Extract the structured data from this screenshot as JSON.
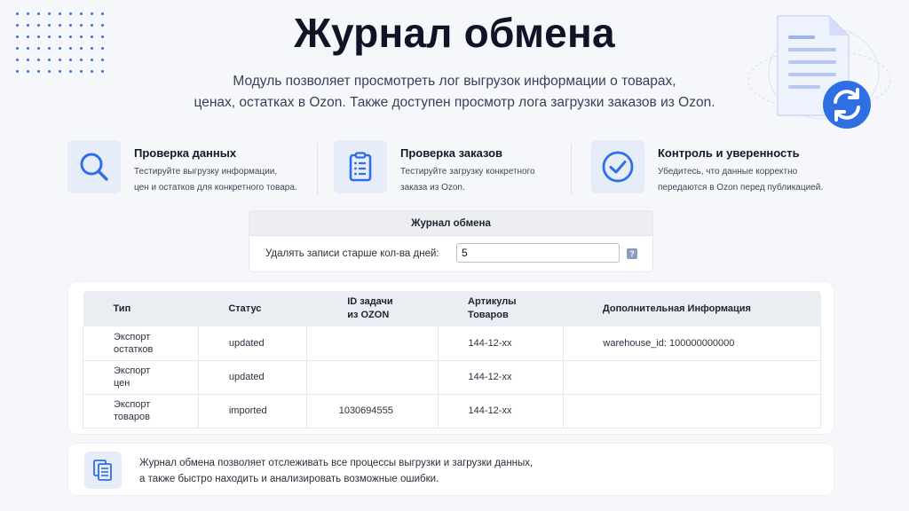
{
  "header": {
    "title": "Журнал обмена",
    "subtitle_line1": "Модуль позволяет просмотреть лог выгрузок информации о товарах,",
    "subtitle_line2": "ценах, остатках в Ozon. Также доступен просмотр лога загрузки заказов из Ozon."
  },
  "features": [
    {
      "title": "Проверка данных",
      "desc": "Тестируйте выгрузку информации,\nцен и остатков для конкретного товара.",
      "icon": "search-icon"
    },
    {
      "title": "Проверка заказов",
      "desc": "Тестируйте загрузку конкретного\nзаказа из Ozon.",
      "icon": "clipboard-icon"
    },
    {
      "title": "Контроль и уверенность",
      "desc": "Убедитесь, что данные корректно\nпередаются в Ozon перед публикацией.",
      "icon": "check-circle-icon"
    }
  ],
  "settings": {
    "title": "Журнал обмена",
    "label": "Удалять записи старше кол-ва дней:",
    "value": "5",
    "help": "?"
  },
  "table": {
    "headers": [
      "Тип",
      "Статус",
      "ID задачи\nиз OZON",
      "Артикулы\nТоваров",
      "Дополнительная Информация"
    ],
    "rows": [
      [
        "Экспорт\nостатков",
        "updated",
        "",
        "144-12-xx",
        "warehouse_id: 100000000000"
      ],
      [
        "Экспорт\nцен",
        "updated",
        "",
        "144-12-xx",
        ""
      ],
      [
        "Экспорт\nтоваров",
        "imported",
        "1030694555",
        "144-12-xx",
        ""
      ]
    ]
  },
  "note": {
    "text": "Журнал обмена позволяет отслеживать все процессы выгрузки и загрузки данных,\nа также быстро находить и анализировать возможные ошибки.",
    "icon": "documents-icon"
  },
  "colors": {
    "accent": "#2f6fe4",
    "icon_bg": "#e6ecf8",
    "background": "#f5f7fb"
  }
}
